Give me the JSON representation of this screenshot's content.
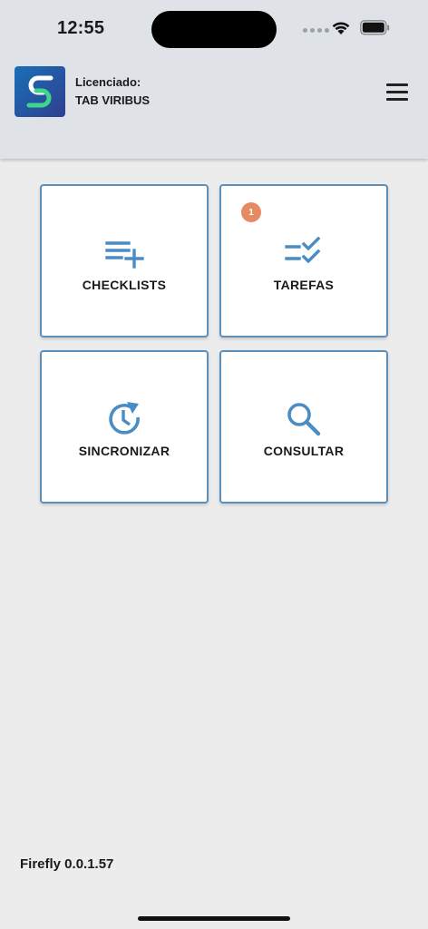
{
  "status_bar": {
    "time": "12:55"
  },
  "header": {
    "logo_icon": "app-logo-icon",
    "license_label": "Licenciado:",
    "license_name": "TAB VIRIBUS",
    "menu_icon": "hamburger-menu-icon"
  },
  "tiles": [
    {
      "label": "CHECKLISTS",
      "icon": "playlist-add-icon"
    },
    {
      "label": "TAREFAS",
      "icon": "checklist-icon",
      "badge": "1"
    },
    {
      "label": "SINCRONIZAR",
      "icon": "sync-clock-icon"
    },
    {
      "label": "CONSULTAR",
      "icon": "search-icon"
    }
  ],
  "colors": {
    "accent": "#4a8cc4",
    "tile_border": "#5b8fbe",
    "badge": "#e58a62",
    "header_bg": "#dfe3e8",
    "page_bg": "#ececec"
  },
  "footer": {
    "version": "Firefly 0.0.1.57"
  }
}
